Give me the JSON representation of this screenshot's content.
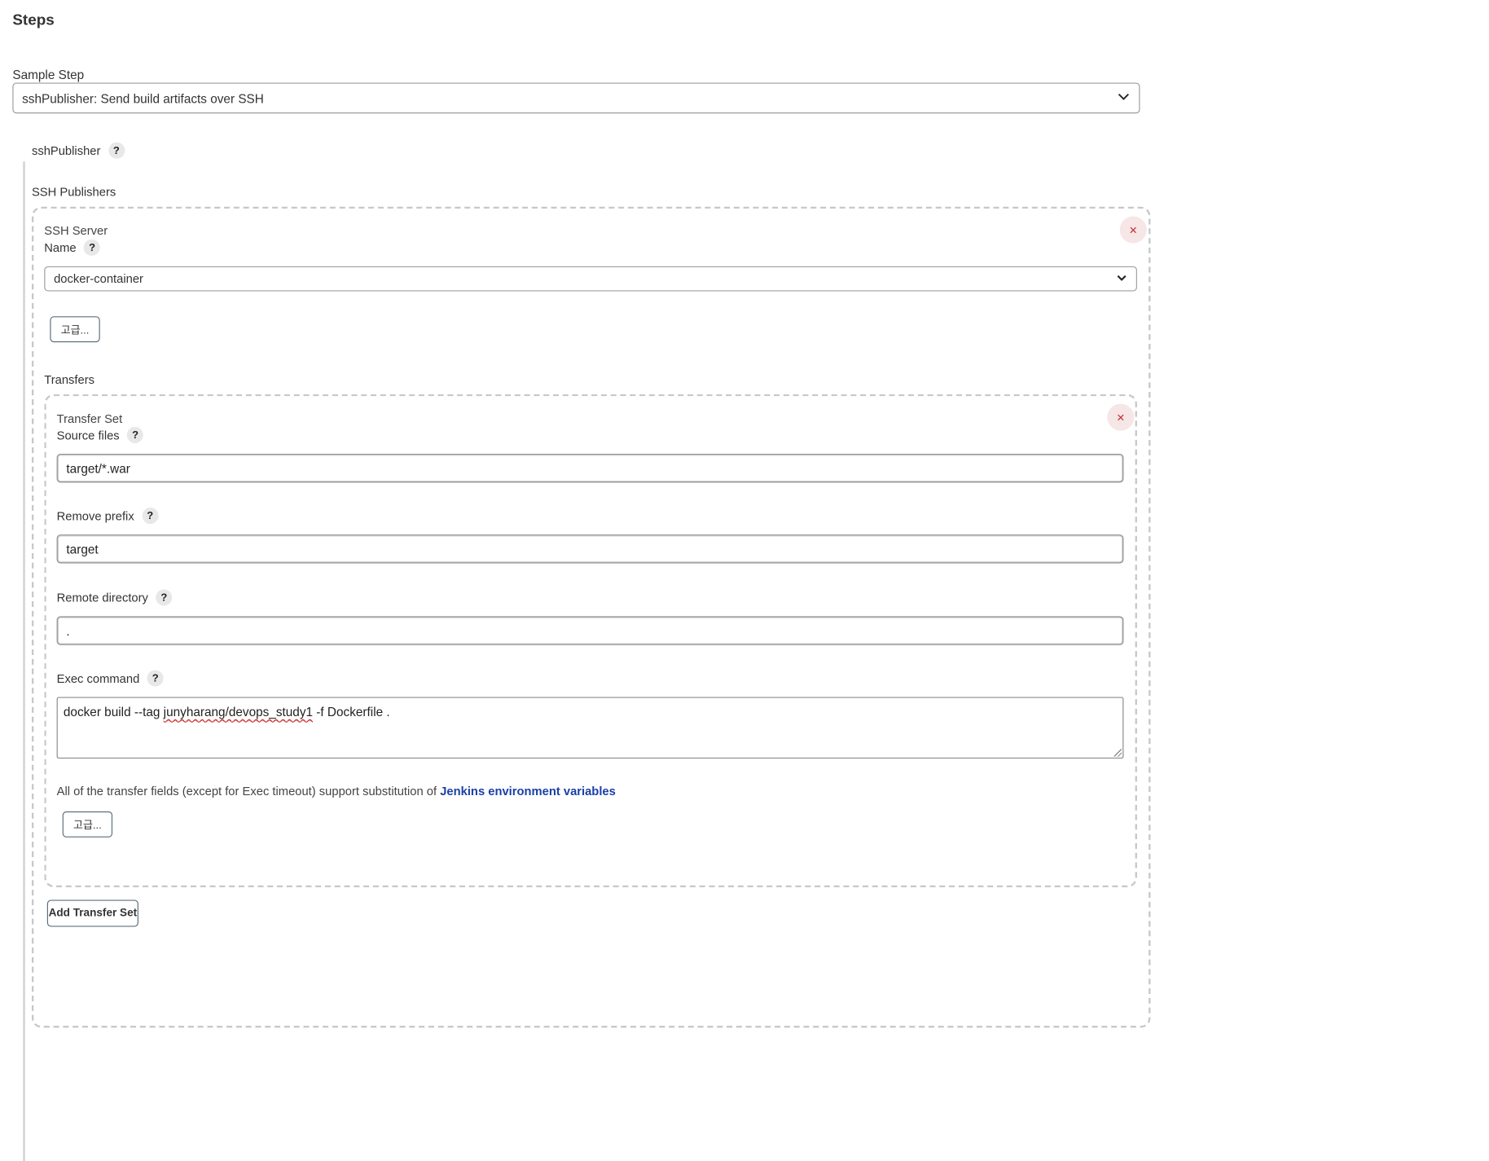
{
  "steps": {
    "title": "Steps",
    "sample_step_label": "Sample Step",
    "sample_step_value": "sshPublisher: Send build artifacts over SSH"
  },
  "publisher": {
    "name": "sshPublisher",
    "ssh_publishers_label": "SSH Publishers",
    "server": {
      "heading": "SSH Server",
      "name_label": "Name",
      "name_value": "docker-container",
      "advanced_label": "고급...",
      "close_glyph": "×"
    },
    "transfers_label": "Transfers",
    "transfer_set": {
      "heading": "Transfer Set",
      "close_glyph": "×",
      "source_files_label": "Source files",
      "source_files_value": "target/*.war",
      "remove_prefix_label": "Remove prefix",
      "remove_prefix_value": "target",
      "remote_directory_label": "Remote directory",
      "remote_directory_value": ".",
      "exec_command_label": "Exec command",
      "exec_command_before": "docker build --tag ",
      "exec_command_flagged": "junyharang/devops_study1",
      "exec_command_after": " -f Dockerfile .",
      "note_text": "All of the transfer fields (except for Exec timeout) support substitution of ",
      "note_link": "Jenkins environment variables",
      "advanced_label": "고급..."
    },
    "add_transfer_set_label": "Add Transfer Set"
  },
  "help_glyph": "?",
  "chevron_glyph": "⌄"
}
